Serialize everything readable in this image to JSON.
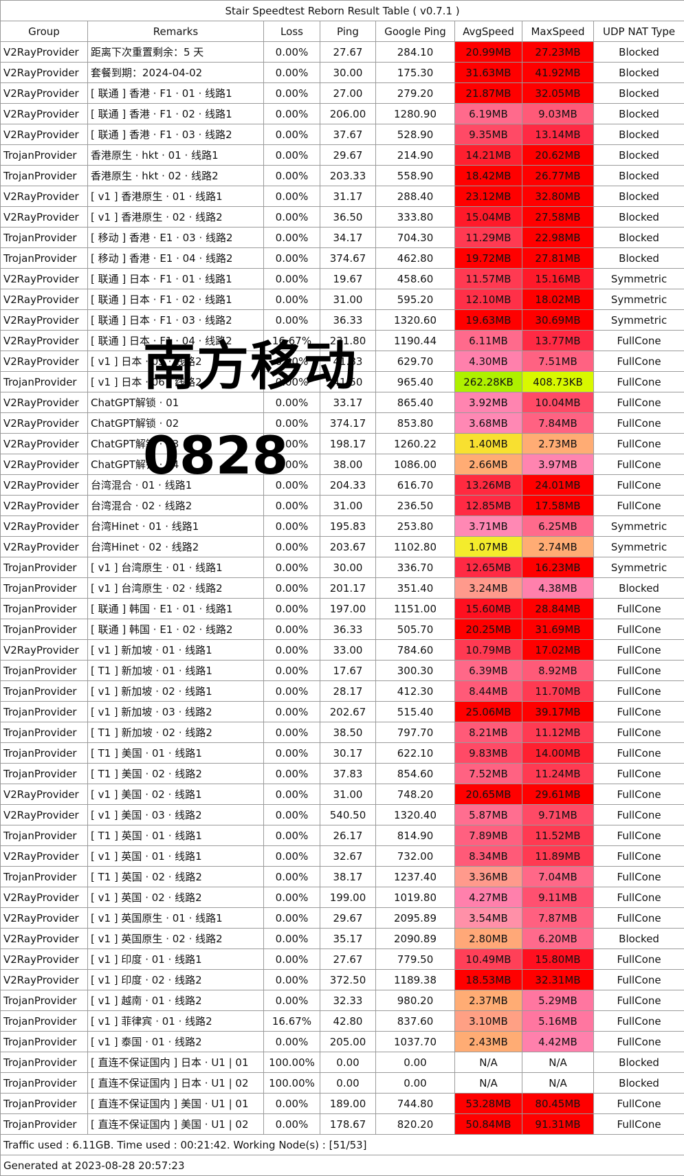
{
  "title": "Stair Speedtest Reborn Result Table ( v0.7.1 )",
  "columns": [
    "Group",
    "Remarks",
    "Loss",
    "Ping",
    "Google Ping",
    "AvgSpeed",
    "MaxSpeed",
    "UDP NAT Type"
  ],
  "rows": [
    {
      "group": "V2RayProvider",
      "remarks": "距离下次重置剩余：5 天",
      "loss": "0.00%",
      "ping": "27.67",
      "gping": "284.10",
      "avg": "20.99MB",
      "max": "27.23MB",
      "nat": "Blocked",
      "avg_color": "#ff0000",
      "max_color": "#ff0000"
    },
    {
      "group": "V2RayProvider",
      "remarks": "套餐到期：2024-04-02",
      "loss": "0.00%",
      "ping": "30.00",
      "gping": "175.30",
      "avg": "31.63MB",
      "max": "41.92MB",
      "nat": "Blocked",
      "avg_color": "#ff0000",
      "max_color": "#ff0000"
    },
    {
      "group": "V2RayProvider",
      "remarks": "[ 联通 ] 香港 · F1 · 01 · 线路1",
      "loss": "0.00%",
      "ping": "27.00",
      "gping": "279.20",
      "avg": "21.87MB",
      "max": "32.05MB",
      "nat": "Blocked",
      "avg_color": "#ff0000",
      "max_color": "#ff0000"
    },
    {
      "group": "V2RayProvider",
      "remarks": "[ 联通 ] 香港 · F1 · 02 · 线路1",
      "loss": "0.00%",
      "ping": "206.00",
      "gping": "1280.90",
      "avg": "6.19MB",
      "max": "9.03MB",
      "nat": "Blocked",
      "avg_color": "#ff6a8c",
      "max_color": "#ff5a78"
    },
    {
      "group": "V2RayProvider",
      "remarks": "[ 联通 ] 香港 · F1 · 03 · 线路2",
      "loss": "0.00%",
      "ping": "37.67",
      "gping": "528.90",
      "avg": "9.35MB",
      "max": "13.14MB",
      "nat": "Blocked",
      "avg_color": "#ff4a66",
      "max_color": "#ff2a44"
    },
    {
      "group": "TrojanProvider",
      "remarks": "香港原生 · hkt · 01 · 线路1",
      "loss": "0.00%",
      "ping": "29.67",
      "gping": "214.90",
      "avg": "14.21MB",
      "max": "20.62MB",
      "nat": "Blocked",
      "avg_color": "#ff2030",
      "max_color": "#ff0000"
    },
    {
      "group": "TrojanProvider",
      "remarks": "香港原生 · hkt · 02 · 线路2",
      "loss": "0.00%",
      "ping": "203.33",
      "gping": "558.90",
      "avg": "18.42MB",
      "max": "26.77MB",
      "nat": "Blocked",
      "avg_color": "#ff0000",
      "max_color": "#ff0000"
    },
    {
      "group": "V2RayProvider",
      "remarks": "[ v1 ] 香港原生 · 01 · 线路1",
      "loss": "0.00%",
      "ping": "31.17",
      "gping": "288.40",
      "avg": "23.12MB",
      "max": "32.80MB",
      "nat": "Blocked",
      "avg_color": "#ff0000",
      "max_color": "#ff0000"
    },
    {
      "group": "V2RayProvider",
      "remarks": "[ v1 ] 香港原生 · 02 · 线路2",
      "loss": "0.00%",
      "ping": "36.50",
      "gping": "333.80",
      "avg": "15.04MB",
      "max": "27.58MB",
      "nat": "Blocked",
      "avg_color": "#ff1a2a",
      "max_color": "#ff0000"
    },
    {
      "group": "TrojanProvider",
      "remarks": "[ 移动 ] 香港 · E1 · 03 · 线路2",
      "loss": "0.00%",
      "ping": "34.17",
      "gping": "704.30",
      "avg": "11.29MB",
      "max": "22.98MB",
      "nat": "Blocked",
      "avg_color": "#ff3a52",
      "max_color": "#ff0000"
    },
    {
      "group": "TrojanProvider",
      "remarks": "[ 移动 ] 香港 · E1 · 04 · 线路2",
      "loss": "0.00%",
      "ping": "374.67",
      "gping": "462.80",
      "avg": "19.72MB",
      "max": "27.81MB",
      "nat": "Blocked",
      "avg_color": "#ff0000",
      "max_color": "#ff0000"
    },
    {
      "group": "V2RayProvider",
      "remarks": "[ 联通 ] 日本 · F1 · 01 · 线路1",
      "loss": "0.00%",
      "ping": "19.67",
      "gping": "458.60",
      "avg": "11.57MB",
      "max": "15.16MB",
      "nat": "Symmetric",
      "avg_color": "#ff3a52",
      "max_color": "#ff1a2a"
    },
    {
      "group": "V2RayProvider",
      "remarks": "[ 联通 ] 日本 · F1 · 02 · 线路1",
      "loss": "0.00%",
      "ping": "31.00",
      "gping": "595.20",
      "avg": "12.10MB",
      "max": "18.02MB",
      "nat": "Symmetric",
      "avg_color": "#ff3048",
      "max_color": "#ff0000"
    },
    {
      "group": "V2RayProvider",
      "remarks": "[ 联通 ] 日本 · F1 · 03 · 线路2",
      "loss": "0.00%",
      "ping": "36.33",
      "gping": "1320.60",
      "avg": "19.63MB",
      "max": "30.69MB",
      "nat": "Symmetric",
      "avg_color": "#ff0000",
      "max_color": "#ff0000"
    },
    {
      "group": "V2RayProvider",
      "remarks": "[ 联通 ] 日本 · F1 · 04 · 线路2",
      "loss": "16.67%",
      "ping": "231.80",
      "gping": "1190.44",
      "avg": "6.11MB",
      "max": "13.77MB",
      "nat": "FullCone",
      "avg_color": "#ff6a8c",
      "max_color": "#ff2a44"
    },
    {
      "group": "V2RayProvider",
      "remarks": "[ v1 ] 日本 · 05 · 线路2",
      "loss": "0.00%",
      "ping": "41.83",
      "gping": "629.70",
      "avg": "4.30MB",
      "max": "7.51MB",
      "nat": "FullCone",
      "avg_color": "#ff80ac",
      "max_color": "#ff6282"
    },
    {
      "group": "TrojanProvider",
      "remarks": "[ v1 ] 日本 · 06 · 线路2",
      "loss": "0.00%",
      "ping": "41.50",
      "gping": "965.40",
      "avg": "262.28KB",
      "max": "408.73KB",
      "nat": "FullCone",
      "avg_color": "#aef000",
      "max_color": "#d8f800"
    },
    {
      "group": "V2RayProvider",
      "remarks": "ChatGPT解锁 · 01",
      "loss": "0.00%",
      "ping": "33.17",
      "gping": "865.40",
      "avg": "3.92MB",
      "max": "10.04MB",
      "nat": "FullCone",
      "avg_color": "#ff84b0",
      "max_color": "#ff4a66"
    },
    {
      "group": "V2RayProvider",
      "remarks": "ChatGPT解锁 · 02",
      "loss": "0.00%",
      "ping": "374.17",
      "gping": "853.80",
      "avg": "3.68MB",
      "max": "7.84MB",
      "nat": "FullCone",
      "avg_color": "#ff88b4",
      "max_color": "#ff6282"
    },
    {
      "group": "V2RayProvider",
      "remarks": "ChatGPT解锁 · 03",
      "loss": "0.00%",
      "ping": "198.17",
      "gping": "1260.22",
      "avg": "1.40MB",
      "max": "2.73MB",
      "nat": "FullCone",
      "avg_color": "#f8e030",
      "max_color": "#ffac74"
    },
    {
      "group": "V2RayProvider",
      "remarks": "ChatGPT解锁 · 04",
      "loss": "0.00%",
      "ping": "38.00",
      "gping": "1086.00",
      "avg": "2.66MB",
      "max": "3.97MB",
      "nat": "FullCone",
      "avg_color": "#ffac74",
      "max_color": "#ff84b0"
    },
    {
      "group": "V2RayProvider",
      "remarks": "台湾混合 · 01 · 线路1",
      "loss": "0.00%",
      "ping": "204.33",
      "gping": "616.70",
      "avg": "13.26MB",
      "max": "24.01MB",
      "nat": "FullCone",
      "avg_color": "#ff2a40",
      "max_color": "#ff0000"
    },
    {
      "group": "V2RayProvider",
      "remarks": "台湾混合 · 02 · 线路2",
      "loss": "0.00%",
      "ping": "31.00",
      "gping": "236.50",
      "avg": "12.85MB",
      "max": "17.58MB",
      "nat": "FullCone",
      "avg_color": "#ff2a44",
      "max_color": "#ff0000"
    },
    {
      "group": "V2RayProvider",
      "remarks": "台湾Hinet · 01 · 线路1",
      "loss": "0.00%",
      "ping": "195.83",
      "gping": "253.80",
      "avg": "3.71MB",
      "max": "6.25MB",
      "nat": "Symmetric",
      "avg_color": "#ff88b4",
      "max_color": "#ff6a8c"
    },
    {
      "group": "V2RayProvider",
      "remarks": "台湾Hinet · 02 · 线路2",
      "loss": "0.00%",
      "ping": "203.67",
      "gping": "1102.80",
      "avg": "1.07MB",
      "max": "2.74MB",
      "nat": "Symmetric",
      "avg_color": "#f4ec2c",
      "max_color": "#ffac74"
    },
    {
      "group": "TrojanProvider",
      "remarks": "[ v1 ] 台湾原生 · 01 · 线路1",
      "loss": "0.00%",
      "ping": "30.00",
      "gping": "336.70",
      "avg": "12.65MB",
      "max": "16.23MB",
      "nat": "Symmetric",
      "avg_color": "#ff2a44",
      "max_color": "#ff0000"
    },
    {
      "group": "TrojanProvider",
      "remarks": "[ v1 ] 台湾原生 · 02 · 线路2",
      "loss": "0.00%",
      "ping": "201.17",
      "gping": "351.40",
      "avg": "3.24MB",
      "max": "4.38MB",
      "nat": "Blocked",
      "avg_color": "#ff9a8c",
      "max_color": "#ff80ac"
    },
    {
      "group": "TrojanProvider",
      "remarks": "[ 联通 ] 韩国 · E1 · 01 · 线路1",
      "loss": "0.00%",
      "ping": "197.00",
      "gping": "1151.00",
      "avg": "15.60MB",
      "max": "28.84MB",
      "nat": "FullCone",
      "avg_color": "#ff1020",
      "max_color": "#ff0000"
    },
    {
      "group": "TrojanProvider",
      "remarks": "[ 联通 ] 韩国 · E1 · 02 · 线路2",
      "loss": "0.00%",
      "ping": "36.33",
      "gping": "505.70",
      "avg": "20.25MB",
      "max": "31.69MB",
      "nat": "FullCone",
      "avg_color": "#ff0000",
      "max_color": "#ff0000"
    },
    {
      "group": "V2RayProvider",
      "remarks": "[ v1 ] 新加坡 · 01 · 线路1",
      "loss": "0.00%",
      "ping": "33.00",
      "gping": "784.60",
      "avg": "10.79MB",
      "max": "17.02MB",
      "nat": "FullCone",
      "avg_color": "#ff3a52",
      "max_color": "#ff0000"
    },
    {
      "group": "TrojanProvider",
      "remarks": "[ T1 ] 新加坡 · 01 · 线路1",
      "loss": "0.00%",
      "ping": "17.67",
      "gping": "300.30",
      "avg": "6.39MB",
      "max": "8.92MB",
      "nat": "FullCone",
      "avg_color": "#ff6888",
      "max_color": "#ff5a78"
    },
    {
      "group": "TrojanProvider",
      "remarks": "[ v1 ] 新加坡 · 02 · 线路1",
      "loss": "0.00%",
      "ping": "28.17",
      "gping": "412.30",
      "avg": "8.44MB",
      "max": "11.70MB",
      "nat": "FullCone",
      "avg_color": "#ff5a78",
      "max_color": "#ff3a52"
    },
    {
      "group": "TrojanProvider",
      "remarks": "[ v1 ] 新加坡 · 03 · 线路2",
      "loss": "0.00%",
      "ping": "202.67",
      "gping": "515.40",
      "avg": "25.06MB",
      "max": "39.17MB",
      "nat": "FullCone",
      "avg_color": "#ff0000",
      "max_color": "#ff0000"
    },
    {
      "group": "TrojanProvider",
      "remarks": "[ T1 ] 新加坡 · 02 · 线路2",
      "loss": "0.00%",
      "ping": "38.50",
      "gping": "797.70",
      "avg": "8.21MB",
      "max": "11.12MB",
      "nat": "FullCone",
      "avg_color": "#ff5a78",
      "max_color": "#ff3a52"
    },
    {
      "group": "TrojanProvider",
      "remarks": "[ T1 ] 美国 · 01 · 线路1",
      "loss": "0.00%",
      "ping": "30.17",
      "gping": "622.10",
      "avg": "9.83MB",
      "max": "14.00MB",
      "nat": "FullCone",
      "avg_color": "#ff4a66",
      "max_color": "#ff2030"
    },
    {
      "group": "TrojanProvider",
      "remarks": "[ T1 ] 美国 · 02 · 线路2",
      "loss": "0.00%",
      "ping": "37.83",
      "gping": "854.60",
      "avg": "7.52MB",
      "max": "11.24MB",
      "nat": "FullCone",
      "avg_color": "#ff6282",
      "max_color": "#ff3a52"
    },
    {
      "group": "V2RayProvider",
      "remarks": "[ v1 ] 美国 · 02 · 线路1",
      "loss": "0.00%",
      "ping": "31.00",
      "gping": "748.20",
      "avg": "20.65MB",
      "max": "29.61MB",
      "nat": "FullCone",
      "avg_color": "#ff0000",
      "max_color": "#ff0000"
    },
    {
      "group": "V2RayProvider",
      "remarks": "[ v1 ] 美国 · 03 · 线路2",
      "loss": "0.00%",
      "ping": "540.50",
      "gping": "1320.40",
      "avg": "5.87MB",
      "max": "9.71MB",
      "nat": "FullCone",
      "avg_color": "#ff6e90",
      "max_color": "#ff4a66"
    },
    {
      "group": "TrojanProvider",
      "remarks": "[ T1 ] 英国 · 01 · 线路1",
      "loss": "0.00%",
      "ping": "26.17",
      "gping": "814.90",
      "avg": "7.89MB",
      "max": "11.52MB",
      "nat": "FullCone",
      "avg_color": "#ff6080",
      "max_color": "#ff3a52"
    },
    {
      "group": "V2RayProvider",
      "remarks": "[ v1 ] 英国 · 01 · 线路1",
      "loss": "0.00%",
      "ping": "32.67",
      "gping": "732.00",
      "avg": "8.34MB",
      "max": "11.89MB",
      "nat": "FullCone",
      "avg_color": "#ff5a78",
      "max_color": "#ff3a52"
    },
    {
      "group": "TrojanProvider",
      "remarks": "[ T1 ] 英国 · 02 · 线路2",
      "loss": "0.00%",
      "ping": "38.17",
      "gping": "1237.40",
      "avg": "3.36MB",
      "max": "7.04MB",
      "nat": "FullCone",
      "avg_color": "#ff9a8c",
      "max_color": "#ff6888"
    },
    {
      "group": "V2RayProvider",
      "remarks": "[ v1 ] 英国 · 02 · 线路2",
      "loss": "0.00%",
      "ping": "199.00",
      "gping": "1019.80",
      "avg": "4.27MB",
      "max": "9.11MB",
      "nat": "FullCone",
      "avg_color": "#ff80ac",
      "max_color": "#ff5070"
    },
    {
      "group": "V2RayProvider",
      "remarks": "[ v1 ] 英国原生 · 01 · 线路1",
      "loss": "0.00%",
      "ping": "29.67",
      "gping": "2095.89",
      "avg": "3.54MB",
      "max": "7.87MB",
      "nat": "FullCone",
      "avg_color": "#ff90a8",
      "max_color": "#ff6080"
    },
    {
      "group": "V2RayProvider",
      "remarks": "[ v1 ] 英国原生 · 02 · 线路2",
      "loss": "0.00%",
      "ping": "35.17",
      "gping": "2090.89",
      "avg": "2.80MB",
      "max": "6.20MB",
      "nat": "Blocked",
      "avg_color": "#ffa878",
      "max_color": "#ff6a8c"
    },
    {
      "group": "V2RayProvider",
      "remarks": "[ v1 ] 印度 · 01 · 线路1",
      "loss": "0.00%",
      "ping": "27.67",
      "gping": "779.50",
      "avg": "10.49MB",
      "max": "15.80MB",
      "nat": "FullCone",
      "avg_color": "#ff4058",
      "max_color": "#ff1020"
    },
    {
      "group": "V2RayProvider",
      "remarks": "[ v1 ] 印度 · 02 · 线路2",
      "loss": "0.00%",
      "ping": "372.50",
      "gping": "1189.38",
      "avg": "18.53MB",
      "max": "32.31MB",
      "nat": "FullCone",
      "avg_color": "#ff0000",
      "max_color": "#ff0000"
    },
    {
      "group": "TrojanProvider",
      "remarks": "[ v1 ] 越南 · 01 · 线路2",
      "loss": "0.00%",
      "ping": "32.33",
      "gping": "980.20",
      "avg": "2.37MB",
      "max": "5.29MB",
      "nat": "FullCone",
      "avg_color": "#ffac74",
      "max_color": "#ff76a0"
    },
    {
      "group": "TrojanProvider",
      "remarks": "[ v1 ] 菲律宾 · 01 · 线路2",
      "loss": "16.67%",
      "ping": "42.80",
      "gping": "837.60",
      "avg": "3.10MB",
      "max": "5.16MB",
      "nat": "FullCone",
      "avg_color": "#ffa084",
      "max_color": "#ff76a0"
    },
    {
      "group": "TrojanProvider",
      "remarks": "[ v1 ] 泰国 · 01 · 线路2",
      "loss": "0.00%",
      "ping": "205.00",
      "gping": "1037.70",
      "avg": "2.43MB",
      "max": "4.42MB",
      "nat": "FullCone",
      "avg_color": "#ffac74",
      "max_color": "#ff80ac"
    },
    {
      "group": "TrojanProvider",
      "remarks": "[ 直连不保证国内 ] 日本 · U1 | 01",
      "loss": "100.00%",
      "ping": "0.00",
      "gping": "0.00",
      "avg": "N/A",
      "max": "N/A",
      "nat": "Blocked",
      "avg_color": "#ffffff",
      "max_color": "#ffffff"
    },
    {
      "group": "TrojanProvider",
      "remarks": "[ 直连不保证国内 ] 日本 · U1 | 02",
      "loss": "100.00%",
      "ping": "0.00",
      "gping": "0.00",
      "avg": "N/A",
      "max": "N/A",
      "nat": "Blocked",
      "avg_color": "#ffffff",
      "max_color": "#ffffff"
    },
    {
      "group": "TrojanProvider",
      "remarks": "[ 直连不保证国内 ] 美国 · U1 | 01",
      "loss": "0.00%",
      "ping": "189.00",
      "gping": "744.80",
      "avg": "53.28MB",
      "max": "80.45MB",
      "nat": "FullCone",
      "avg_color": "#ff0000",
      "max_color": "#ff0000"
    },
    {
      "group": "TrojanProvider",
      "remarks": "[ 直连不保证国内 ] 美国 · U1 | 02",
      "loss": "0.00%",
      "ping": "178.67",
      "gping": "820.20",
      "avg": "50.84MB",
      "max": "91.31MB",
      "nat": "FullCone",
      "avg_color": "#ff0000",
      "max_color": "#ff0000"
    }
  ],
  "footer": {
    "traffic": "Traffic used : 6.11GB. Time used : 00:21:42. Working Node(s) : [51/53]",
    "generated": "Generated at 2023-08-28 20:57:23"
  },
  "watermark": {
    "line1": "南方移动",
    "line2": "0828"
  }
}
